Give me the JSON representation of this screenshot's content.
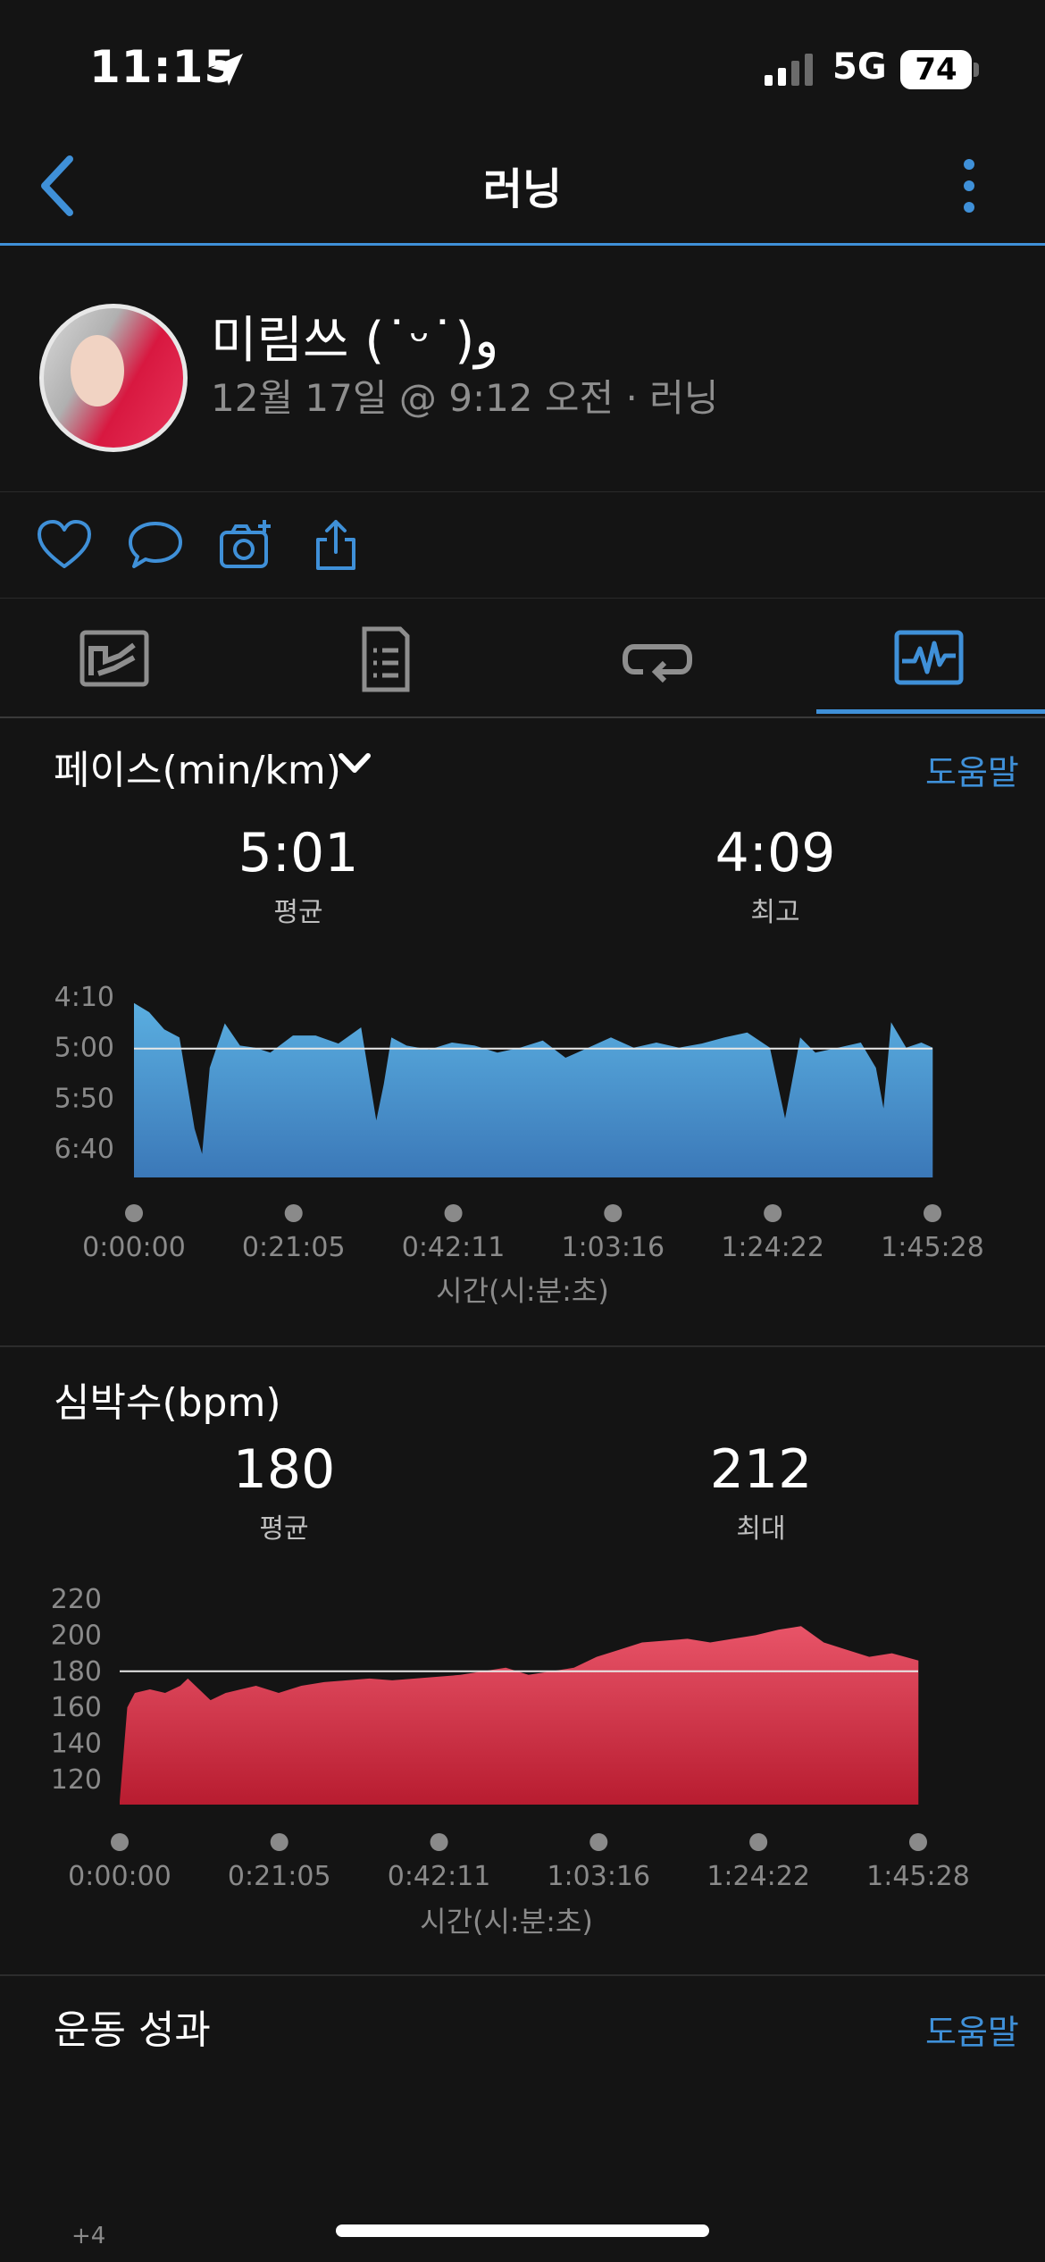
{
  "status": {
    "time": "11:15",
    "network": "5G",
    "battery": "74"
  },
  "nav": {
    "title": "러닝"
  },
  "profile": {
    "name": "미림쓰 (˙ᵕ˙)و",
    "meta": "12월 17일 @ 9:12 오전 · 러닝"
  },
  "actions": [
    "heart-icon",
    "comment-icon",
    "camera-add-icon",
    "share-icon"
  ],
  "tabs": [
    "map-icon",
    "details-icon",
    "laps-icon",
    "charts-icon"
  ],
  "pace": {
    "title": "페이스(min/km)",
    "help": "도움말",
    "avg_value": "5:01",
    "avg_label": "평균",
    "best_value": "4:09",
    "best_label": "최고",
    "y_ticks": [
      "4:10",
      "5:00",
      "5:50",
      "6:40"
    ],
    "x_ticks": [
      "0:00:00",
      "0:21:05",
      "0:42:11",
      "1:03:16",
      "1:24:22",
      "1:45:28"
    ],
    "x_label": "시간(시:분:초)",
    "color": "#4a9fd8"
  },
  "hr": {
    "title": "심박수(bpm)",
    "avg_value": "180",
    "avg_label": "평균",
    "max_value": "212",
    "max_label": "최대",
    "y_ticks": [
      "220",
      "200",
      "180",
      "160",
      "140",
      "120"
    ],
    "x_ticks": [
      "0:00:00",
      "0:21:05",
      "0:42:11",
      "1:03:16",
      "1:24:22",
      "1:45:28"
    ],
    "x_label": "시간(시:분:초)",
    "color": "#d8324a"
  },
  "performance": {
    "title": "운동 성과",
    "help": "도움말",
    "first_tick": "+4"
  },
  "chart_data": [
    {
      "type": "area",
      "ylabel": "페이스(min/km)",
      "xlabel": "시간(시:분:초)",
      "y_inverted": true,
      "y_ticks": [
        "4:10",
        "5:00",
        "5:50",
        "6:40"
      ],
      "x_ticks": [
        "0:00:00",
        "0:21:05",
        "0:42:11",
        "1:03:16",
        "1:24:22",
        "1:45:28"
      ],
      "reference_line": "5:01",
      "x_min": [
        0,
        2,
        4,
        6,
        8,
        9,
        10,
        12,
        14,
        16,
        18,
        21,
        24,
        27,
        30,
        32,
        33,
        34,
        36,
        39,
        42,
        45,
        48,
        51,
        54,
        57,
        60,
        63,
        66,
        69,
        72,
        75,
        78,
        81,
        84,
        86,
        87,
        88,
        90,
        93,
        96,
        98,
        99,
        100,
        102,
        104,
        105.5
      ],
      "pace_sec_per_km": [
        256,
        265,
        282,
        290,
        380,
        405,
        320,
        276,
        298,
        300,
        305,
        288,
        288,
        296,
        280,
        372,
        336,
        290,
        298,
        302,
        295,
        298,
        305,
        300,
        293,
        310,
        300,
        290,
        300,
        295,
        300,
        296,
        290,
        285,
        300,
        370,
        330,
        290,
        305,
        300,
        295,
        320,
        360,
        275,
        300,
        295,
        300
      ]
    },
    {
      "type": "area",
      "ylabel": "심박수(bpm)",
      "xlabel": "시간(시:분:초)",
      "y_ticks": [
        120,
        140,
        160,
        180,
        200,
        220
      ],
      "x_ticks": [
        "0:00:00",
        "0:21:05",
        "0:42:11",
        "1:03:16",
        "1:24:22",
        "1:45:28"
      ],
      "reference_line": 180,
      "x_min": [
        0,
        1,
        2,
        4,
        6,
        8,
        9,
        10,
        12,
        14,
        16,
        18,
        21,
        24,
        27,
        30,
        33,
        36,
        39,
        42,
        45,
        48,
        51,
        54,
        57,
        60,
        63,
        66,
        69,
        72,
        75,
        78,
        81,
        84,
        87,
        90,
        93,
        96,
        99,
        102,
        105.5
      ],
      "bpm": [
        108,
        160,
        168,
        170,
        168,
        172,
        176,
        172,
        164,
        168,
        170,
        172,
        168,
        172,
        174,
        175,
        176,
        175,
        176,
        177,
        178,
        180,
        182,
        178,
        180,
        182,
        188,
        192,
        196,
        197,
        198,
        196,
        198,
        200,
        203,
        205,
        196,
        192,
        188,
        190,
        186
      ]
    }
  ]
}
